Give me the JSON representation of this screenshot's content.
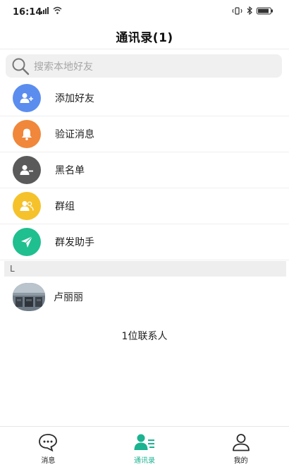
{
  "status_bar": {
    "time": "16:14",
    "signal_icon": "signal-icon",
    "wifi_icon": "wifi-icon",
    "vibrate_icon": "vibrate-icon",
    "bluetooth_icon": "bluetooth-icon",
    "battery_icon": "battery-icon"
  },
  "header": {
    "title": "通讯录(1)"
  },
  "search": {
    "placeholder": "搜索本地好友",
    "icon": "search-icon"
  },
  "menu": {
    "items": [
      {
        "label": "添加好友",
        "icon": "add-user-icon",
        "color": "#5b8def"
      },
      {
        "label": "验证消息",
        "icon": "bell-icon",
        "color": "#f0873a"
      },
      {
        "label": "黑名单",
        "icon": "remove-user-icon",
        "color": "#5a5a5a"
      },
      {
        "label": "群组",
        "icon": "group-icon",
        "color": "#f5c22b"
      },
      {
        "label": "群发助手",
        "icon": "send-icon",
        "color": "#1fbf8f"
      }
    ]
  },
  "contacts": {
    "section_letter": "L",
    "items": [
      {
        "name": "卢丽丽",
        "avatar": "avatar-photo"
      }
    ],
    "count_text": "1位联系人"
  },
  "bottom_nav": {
    "tabs": [
      {
        "label": "消息",
        "icon": "chat-bubble-icon",
        "active": false
      },
      {
        "label": "通讯录",
        "icon": "contacts-icon",
        "active": true
      },
      {
        "label": "我的",
        "icon": "profile-icon",
        "active": false
      }
    ]
  },
  "colors": {
    "accent": "#1bb390",
    "search_bg": "#f0f0f0",
    "section_bg": "#eeeeee"
  }
}
